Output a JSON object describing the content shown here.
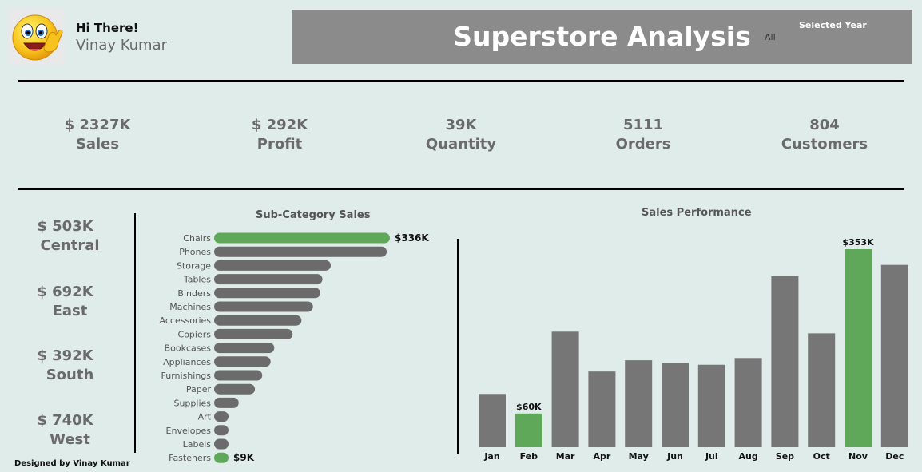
{
  "header": {
    "greeting": "Hi There!",
    "user_name": "Vinay Kumar",
    "title": "Superstore Analysis",
    "filter_label": "Selected Year",
    "filter_value": "All"
  },
  "kpis": [
    {
      "value": "$ 2327K",
      "label": "Sales"
    },
    {
      "value": "$ 292K",
      "label": "Profit"
    },
    {
      "value": "39K",
      "label": "Quantity"
    },
    {
      "value": "5111",
      "label": "Orders"
    },
    {
      "value": "804",
      "label": "Customers"
    }
  ],
  "regions": [
    {
      "value": "$ 503K",
      "label": "Central"
    },
    {
      "value": "$ 692K",
      "label": "East"
    },
    {
      "value": "$ 392K",
      "label": "South"
    },
    {
      "value": "$ 740K",
      "label": "West"
    }
  ],
  "footer": "Designed by Vinay Kumar",
  "colors": {
    "background": "#dfecea",
    "banner": "#8b8b8b",
    "bar": "#6b6b6b",
    "highlight": "#5fa85a"
  },
  "chart_data": [
    {
      "type": "bar",
      "orientation": "horizontal",
      "title": "Sub-Category Sales",
      "categories": [
        "Chairs",
        "Phones",
        "Storage",
        "Tables",
        "Binders",
        "Machines",
        "Accessories",
        "Copiers",
        "Bookcases",
        "Appliances",
        "Furnishings",
        "Paper",
        "Supplies",
        "Art",
        "Envelopes",
        "Labels",
        "Fasteners"
      ],
      "values": [
        336,
        330,
        223,
        207,
        203,
        189,
        167,
        150,
        115,
        108,
        92,
        78,
        47,
        27,
        16,
        12,
        9
      ],
      "highlighted": [
        "Chairs",
        "Fasteners"
      ],
      "data_labels": {
        "Chairs": "$336K",
        "Fasteners": "$9K"
      }
    },
    {
      "type": "bar",
      "title": "Sales Performance",
      "categories": [
        "Jan",
        "Feb",
        "Mar",
        "Apr",
        "May",
        "Jun",
        "Jul",
        "Aug",
        "Sep",
        "Oct",
        "Nov",
        "Dec"
      ],
      "values": [
        95,
        60,
        206,
        135,
        155,
        150,
        147,
        159,
        305,
        203,
        353,
        325
      ],
      "highlighted": [
        "Feb",
        "Nov"
      ],
      "data_labels": {
        "Feb": "$60K",
        "Nov": "$353K"
      }
    }
  ]
}
